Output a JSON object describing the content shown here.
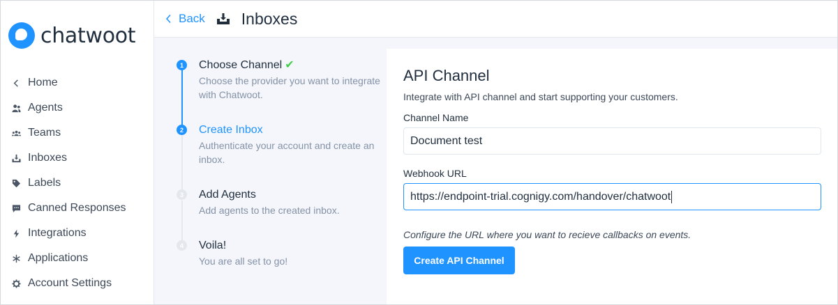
{
  "app": {
    "brand": "chatwoot",
    "accent": "#1f93ff"
  },
  "sidebar": {
    "items": [
      {
        "label": "Home",
        "icon": "chevron-left-icon"
      },
      {
        "label": "Agents",
        "icon": "agents-icon"
      },
      {
        "label": "Teams",
        "icon": "teams-icon"
      },
      {
        "label": "Inboxes",
        "icon": "inbox-icon"
      },
      {
        "label": "Labels",
        "icon": "tag-icon"
      },
      {
        "label": "Canned Responses",
        "icon": "chat-icon"
      },
      {
        "label": "Integrations",
        "icon": "flash-icon"
      },
      {
        "label": "Applications",
        "icon": "asterisk-icon"
      },
      {
        "label": "Account Settings",
        "icon": "gear-icon"
      }
    ]
  },
  "header": {
    "back_label": "Back",
    "title": "Inboxes",
    "icon": "inbox-download-icon"
  },
  "steps": [
    {
      "num": "1",
      "title": "Choose Channel",
      "desc": "Choose the provider you want to integrate with Chatwoot.",
      "done": true
    },
    {
      "num": "2",
      "title": "Create Inbox",
      "desc": "Authenticate your account and create an inbox.",
      "current": true
    },
    {
      "num": "3",
      "title": "Add Agents",
      "desc": "Add agents to the created inbox."
    },
    {
      "num": "4",
      "title": "Voila!",
      "desc": "You are all set to go!"
    }
  ],
  "form": {
    "title": "API Channel",
    "subtitle": "Integrate with API channel and start supporting your customers.",
    "channel_name_label": "Channel Name",
    "channel_name_value": "Document test",
    "webhook_label": "Webhook URL",
    "webhook_value": "https://endpoint-trial.cognigy.com/handover/chatwoot",
    "help_text": "Configure the URL where you want to recieve callbacks on events.",
    "submit_label": "Create API Channel"
  }
}
